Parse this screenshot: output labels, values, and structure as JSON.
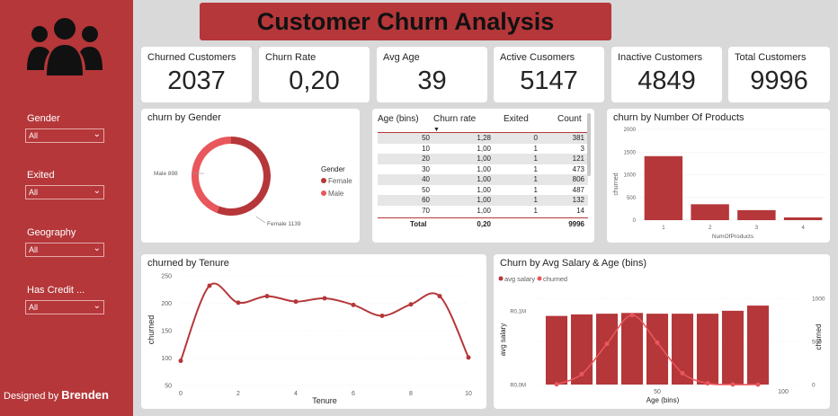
{
  "title": "Customer Churn Analysis",
  "sidebar": {
    "filters": [
      {
        "label": "Gender",
        "value": "All"
      },
      {
        "label": "Exited",
        "value": "All"
      },
      {
        "label": "Geography",
        "value": "All"
      },
      {
        "label": "Has Credit ...",
        "value": "All"
      }
    ],
    "designed_prefix": "Designed by",
    "designer": "Brenden"
  },
  "kpis": [
    {
      "label": "Churned Customers",
      "value": "2037"
    },
    {
      "label": "Churn Rate",
      "value": "0,20"
    },
    {
      "label": "Avg Age",
      "value": "39"
    },
    {
      "label": "Active Cusomers",
      "value": "5147"
    },
    {
      "label": "Inactive Customers",
      "value": "4849"
    },
    {
      "label": "Total Customers",
      "value": "9996"
    }
  ],
  "colors": {
    "primary": "#b5373a",
    "secondary": "#e8575b"
  },
  "table": {
    "headers": [
      "Age (bins)",
      "Churn rate",
      "Exited",
      "Count"
    ],
    "sort_icon": "▼",
    "rows": [
      [
        "50",
        "1,28",
        "0",
        "381"
      ],
      [
        "10",
        "1,00",
        "1",
        "3"
      ],
      [
        "20",
        "1,00",
        "1",
        "121"
      ],
      [
        "30",
        "1,00",
        "1",
        "473"
      ],
      [
        "40",
        "1,00",
        "1",
        "806"
      ],
      [
        "50",
        "1,00",
        "1",
        "487"
      ],
      [
        "60",
        "1,00",
        "1",
        "132"
      ],
      [
        "70",
        "1,00",
        "1",
        "14"
      ]
    ],
    "total": [
      "Total",
      "0,20",
      "",
      "9996"
    ]
  },
  "chart_data": [
    {
      "type": "pie",
      "title": "churn by Gender",
      "legend_title": "Gender",
      "legend_position": "right",
      "slices": [
        {
          "name": "Female",
          "value": 1139,
          "label": "Female 1139",
          "color": "#b5373a"
        },
        {
          "name": "Male",
          "value": 898,
          "label": "Male 898",
          "color": "#e8575b"
        }
      ]
    },
    {
      "type": "bar",
      "title": "churn by Number Of Products",
      "xlabel": "NumOfProducts",
      "ylabel": "churned",
      "categories": [
        "1",
        "2",
        "3",
        "4"
      ],
      "values": [
        1410,
        350,
        220,
        60
      ],
      "ylim": [
        0,
        2000
      ],
      "yticks": [
        "0",
        "500",
        "1000",
        "1500",
        "2000"
      ]
    },
    {
      "type": "line",
      "title": "churned by Tenure",
      "xlabel": "Tenure",
      "ylabel": "churned",
      "x": [
        0,
        1,
        2,
        3,
        4,
        5,
        6,
        7,
        8,
        9,
        10
      ],
      "values": [
        95,
        232,
        201,
        213,
        203,
        209,
        197,
        177,
        198,
        213,
        101
      ],
      "xlim": [
        0,
        10
      ],
      "ylim": [
        50,
        250
      ],
      "xticks": [
        "0",
        "2",
        "4",
        "6",
        "8",
        "10"
      ],
      "yticks": [
        "50",
        "100",
        "150",
        "200",
        "250"
      ]
    },
    {
      "type": "bar",
      "title": "Churn by Avg Salary & Age (bins)",
      "xlabel": "Age (bins)",
      "ylabel": "avg salary",
      "y2label": "churned",
      "legend": [
        "avg salary",
        "churned"
      ],
      "legend_position": "top-left",
      "x": [
        10,
        20,
        30,
        40,
        50,
        60,
        70,
        80,
        90
      ],
      "series": [
        {
          "name": "avg salary",
          "values": [
            0.93,
            0.95,
            0.96,
            0.97,
            0.96,
            0.96,
            0.96,
            1.0,
            1.07
          ]
        },
        {
          "name": "churned",
          "values": [
            3,
            121,
            473,
            806,
            487,
            132,
            14,
            1,
            0
          ]
        }
      ],
      "xlim": [
        0,
        100
      ],
      "ylim": [
        0,
        1.4
      ],
      "y2lim": [
        0,
        1200
      ],
      "xticks": [
        "50",
        "100"
      ],
      "yticks": [
        "R0,0M",
        "R0,1M"
      ],
      "y2ticks": [
        "0",
        "500",
        "1000"
      ]
    }
  ]
}
